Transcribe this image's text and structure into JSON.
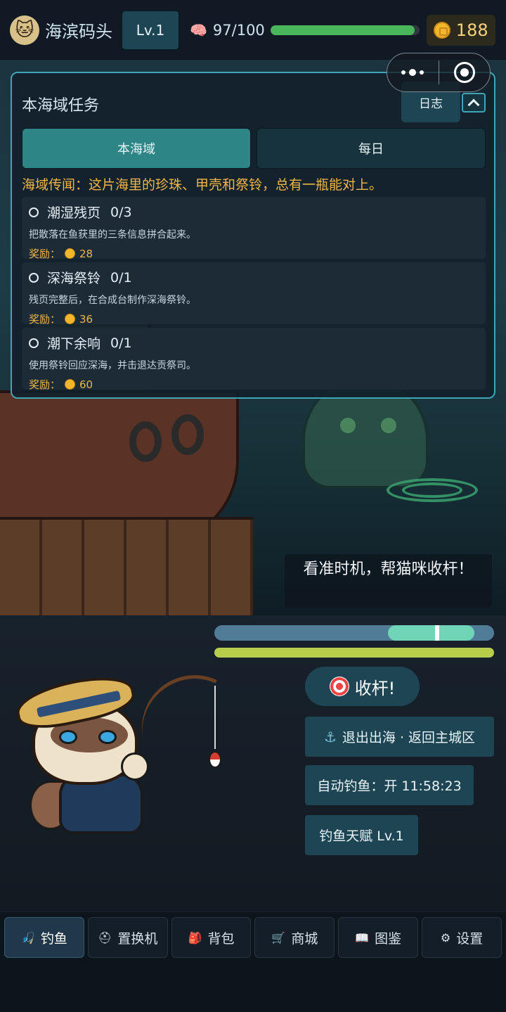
{
  "topbar": {
    "location": "海滨码头",
    "level": "Lv.1",
    "energy_text": "97/100",
    "energy_fraction": 0.97,
    "coins": "188",
    "avatar_icon": "cat-avatar-icon",
    "energy_icon": "brain-icon",
    "coin_icon": "coin-icon"
  },
  "quest_panel": {
    "title": "本海域任务",
    "log_label": "日志",
    "tabs": [
      {
        "label": "本海域",
        "active": true
      },
      {
        "label": "每日",
        "active": false
      }
    ],
    "rumor": "海域传闻：这片海里的珍珠、甲壳和祭铃，总有一瓶能对上。",
    "quests": [
      {
        "name": "潮湿残页",
        "progress": "0/3",
        "desc": "把散落在鱼获里的三条信息拼合起来。",
        "reward_label": "奖励：",
        "reward": "28"
      },
      {
        "name": "深海祭铃",
        "progress": "0/1",
        "desc": "残页完整后，在合成台制作深海祭铃。",
        "reward_label": "奖励：",
        "reward": "36"
      },
      {
        "name": "潮下余响",
        "progress": "0/1",
        "desc": "使用祭铃回应深海，并击退达贡祭司。",
        "reward_label": "奖励：",
        "reward": "60"
      }
    ]
  },
  "fishing": {
    "hint": "看准时机，帮猫咪收杆！",
    "timing_zone_start": 0.62,
    "timing_zone_end": 0.93,
    "needle_position": 0.79,
    "stamina_fraction": 1.0,
    "reel_label": "收杆!",
    "exit_label": "退出出海 · 返回主城区",
    "auto_label": "自动钓鱼：开 11:58:23",
    "talent_label": "钓鱼天赋 Lv.1"
  },
  "nav": [
    {
      "label": "钓鱼",
      "icon": "fishing-icon",
      "glyph": "🎣",
      "active": true
    },
    {
      "label": "置换机",
      "icon": "exchange-icon",
      "glyph": "⛑",
      "active": false
    },
    {
      "label": "背包",
      "icon": "backpack-icon",
      "glyph": "🎒",
      "active": false
    },
    {
      "label": "商城",
      "icon": "cart-icon",
      "glyph": "🛒",
      "active": false
    },
    {
      "label": "图鉴",
      "icon": "book-icon",
      "glyph": "📖",
      "active": false
    },
    {
      "label": "设置",
      "icon": "gear-icon",
      "glyph": "⚙",
      "active": false
    }
  ],
  "colors": {
    "accent": "#3fa6b8",
    "button": "#1d4553",
    "active_tab": "#2e8585",
    "gold_text": "#f0b545",
    "energy": "#4ab65b",
    "stamina": "#b9cf4c"
  }
}
